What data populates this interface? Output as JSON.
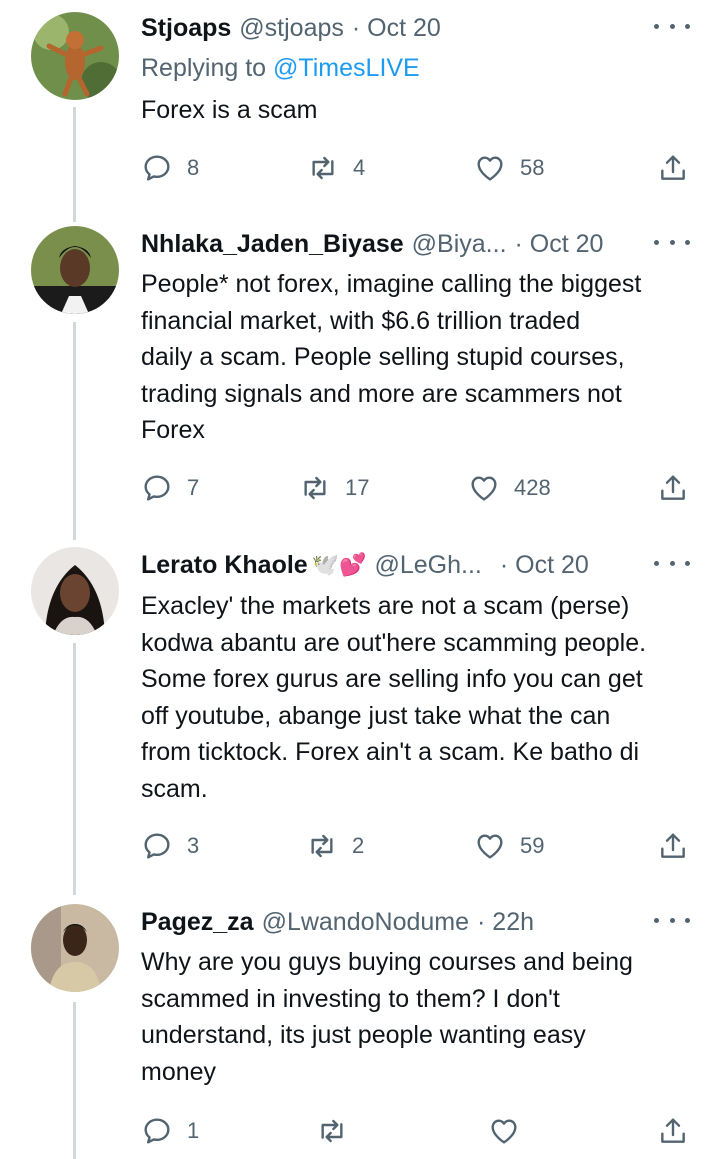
{
  "colors": {
    "text": "#0f1419",
    "secondary": "#536471",
    "link": "#1d9bf0",
    "thread": "#cfd9de"
  },
  "tweets": [
    {
      "name": "Stjoaps",
      "handle": "@stjoaps",
      "date": "· Oct 20",
      "replying_label": "Replying to ",
      "replying_to": "@TimesLIVE",
      "lines": [
        "Forex is a scam"
      ],
      "replies": "8",
      "retweets": "4",
      "likes": "58"
    },
    {
      "name": "Nhlaka_Jaden_Biyase",
      "handle": "@Biya...",
      "date": "· Oct 20",
      "lines": [
        "People* not forex, imagine calling the biggest",
        "financial market, with $6.6 trillion traded",
        "daily a scam. People selling stupid courses,",
        "trading signals and more are scammers not",
        "Forex"
      ],
      "replies": "7",
      "retweets": "17",
      "likes": "428"
    },
    {
      "name": "Lerato Khaole",
      "name_emoji": "🕊️💕",
      "handle": "@LeGh...",
      "date": "· Oct 20",
      "lines": [
        "Exacley' the markets are not a scam (perse)",
        "kodwa abantu are out'here scamming people.",
        "Some forex gurus are selling info you can get",
        "off youtube, abange just take what the can",
        "from ticktock. Forex ain't a scam. Ke batho di",
        "scam."
      ],
      "replies": "3",
      "retweets": "2",
      "likes": "59"
    },
    {
      "name": "Pagez_za",
      "handle": "@LwandoNodume",
      "date": "· 22h",
      "lines": [
        "Why are you guys buying courses and being",
        "scammed in investing to them? I don't",
        "understand, its just people wanting easy",
        "money"
      ],
      "replies": "1",
      "retweets": "",
      "likes": ""
    }
  ]
}
